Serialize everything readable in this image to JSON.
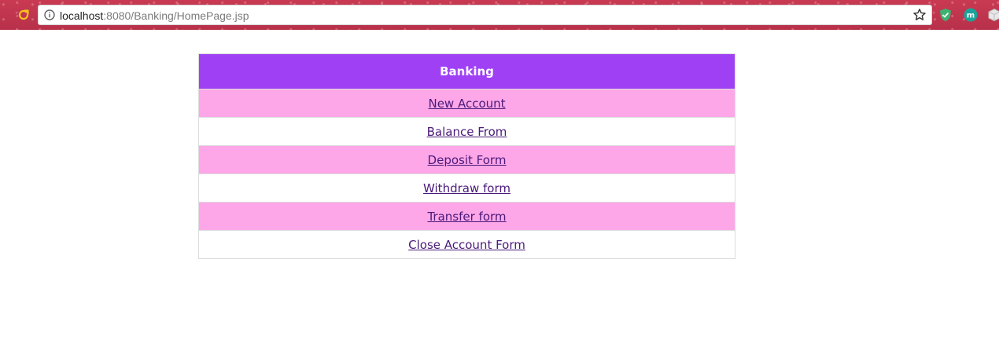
{
  "browser": {
    "url_host": "localhost",
    "url_path": ":8080/Banking/HomePage.jsp",
    "icons": {
      "reload": "reload-icon",
      "info": "info-icon",
      "bookmark": "star-icon",
      "extensions": [
        "shield-extension-icon",
        "m-extension-icon",
        "cube-extension-icon"
      ]
    },
    "ext_m_label": "m"
  },
  "banking": {
    "header": "Banking",
    "links": [
      {
        "label": "New Account"
      },
      {
        "label": "Balance From"
      },
      {
        "label": "Deposit Form"
      },
      {
        "label": "Withdraw form"
      },
      {
        "label": "Transfer form"
      },
      {
        "label": "Close Account Form"
      }
    ]
  },
  "colors": {
    "header_bg": "#a040f5",
    "row_pink": "#fda6e8",
    "link": "#4a1a7a",
    "toolbar": "#c93a52"
  }
}
